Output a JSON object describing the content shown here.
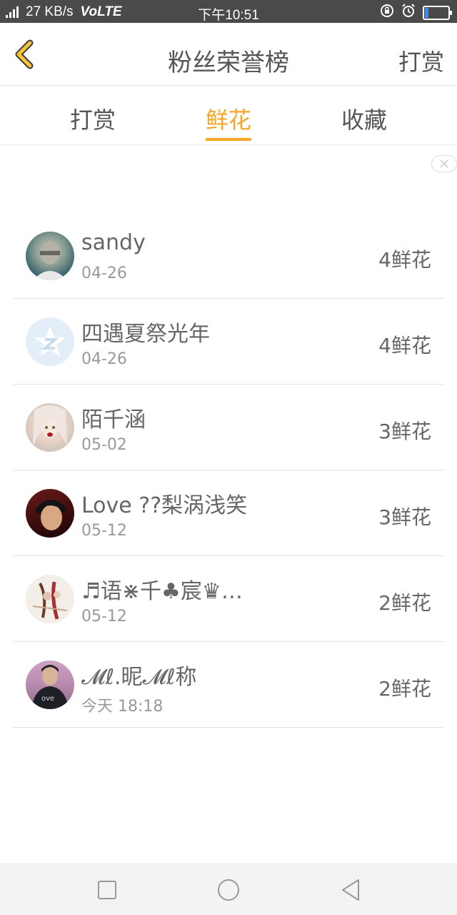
{
  "status_bar": {
    "network": "4G",
    "speed": "27 KB/s",
    "volte": "VoLTE",
    "time": "下午10:51",
    "icons": [
      "rotation-lock-icon",
      "alarm-icon",
      "battery-icon"
    ],
    "battery_level": 0.15,
    "battery_color": "#2f8bff"
  },
  "header": {
    "title": "粉丝荣誉榜",
    "action": "打赏",
    "back_icon": "chevron-left-icon",
    "back_color": "#f5c33b"
  },
  "tabs": [
    {
      "label": "打赏",
      "active": false
    },
    {
      "label": "鲜花",
      "active": true
    },
    {
      "label": "收藏",
      "active": false
    }
  ],
  "accent": "#f5a623",
  "fans": [
    {
      "name": "sandy",
      "date": "04-26",
      "count": "4鲜花",
      "avatar": "photo-avatar"
    },
    {
      "name": "四遇夏祭光年",
      "date": "04-26",
      "count": "4鲜花",
      "avatar": "default-star-avatar"
    },
    {
      "name": "陌千涵",
      "date": "05-02",
      "count": "3鲜花",
      "avatar": "photo-avatar"
    },
    {
      "name": "Love ??梨涡浅笑",
      "date": "05-12",
      "count": "3鲜花",
      "avatar": "photo-avatar"
    },
    {
      "name": "♬语⋇千♣宸♛…",
      "date": "05-12",
      "count": "2鲜花",
      "avatar": "photo-avatar"
    },
    {
      "name": "𝓜ℓ.昵𝓜ℓ称",
      "date": "今天 18:18",
      "count": "2鲜花",
      "avatar": "photo-avatar"
    }
  ],
  "navbar": {
    "buttons": [
      "recent-apps-icon",
      "home-icon",
      "back-triangle-icon"
    ]
  }
}
